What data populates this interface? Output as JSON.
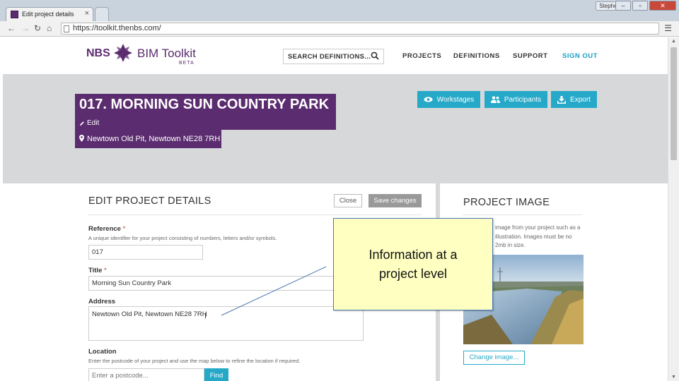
{
  "browser": {
    "tab_title": "Edit project details",
    "user_badge": "Stephen",
    "url": "https://toolkit.thenbs.com/"
  },
  "header": {
    "logo_nbs": "NBS",
    "logo_product": "BIM Toolkit",
    "logo_beta": "BETA",
    "search_label": "SEARCH DEFINITIONS...",
    "nav": {
      "projects": "PROJECTS",
      "definitions": "DEFINITIONS",
      "support": "SUPPORT",
      "signout": "SIGN OUT"
    }
  },
  "project": {
    "title": "017. MORNING SUN COUNTRY PARK",
    "edit_label": "Edit",
    "address": "Newtown Old Pit, Newtown NE28 7RH"
  },
  "actions": {
    "workstages": "Workstages",
    "participants": "Participants",
    "export": "Export"
  },
  "edit_panel": {
    "heading": "EDIT PROJECT DETAILS",
    "close_label": "Close",
    "save_label": "Save changes",
    "reference_label": "Reference",
    "reference_help": "A unique identifier for your project consisting of numbers, letters and/or symbols.",
    "reference_value": "017",
    "title_label": "Title",
    "title_value": "Morning Sun Country Park",
    "address_label": "Address",
    "address_value": "Newtown Old Pit, Newtown NE28 7RH",
    "location_label": "Location",
    "location_help": "Enter the postcode of your project and use the map below to refine the location if required.",
    "postcode_placeholder": "Enter a postcode...",
    "find_label": "Find",
    "required_mark": "*"
  },
  "image_panel": {
    "heading": "PROJECT IMAGE",
    "description": "image from your project such as a illustration. Images must be no 2mb in size.",
    "change_label": "Change image..."
  },
  "callout": {
    "text": "Information at a project level"
  },
  "colors": {
    "brand_purple": "#5b2c6f",
    "accent_teal": "#26a9c8",
    "callout_yellow": "#ffffc2"
  }
}
